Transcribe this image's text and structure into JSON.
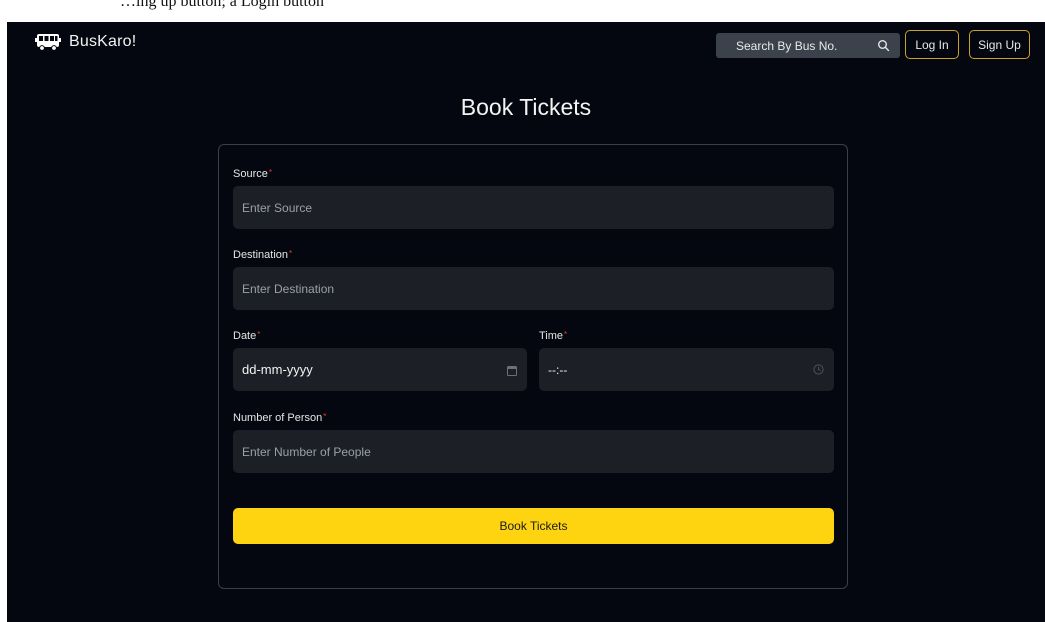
{
  "top_strip": {
    "text": "…ing up button; a Login button"
  },
  "navbar": {
    "brand_name": "BusKaro!",
    "brand_icon": "bus-icon",
    "search_placeholder": "Search By Bus No.",
    "search_icon": "search-icon",
    "login_label": "Log In",
    "signup_label": "Sign Up",
    "accent_color": "#c9a227"
  },
  "page": {
    "title": "Book Tickets"
  },
  "form": {
    "required_marker": "*",
    "source": {
      "label": "Source",
      "placeholder": "Enter Source"
    },
    "destination": {
      "label": "Destination",
      "placeholder": "Enter Destination"
    },
    "date": {
      "label": "Date",
      "value": "dd-mm-yyyy",
      "icon": "calendar-icon"
    },
    "time": {
      "label": "Time",
      "value": "--:--",
      "icon": "clock-icon"
    },
    "people": {
      "label": "Number of Person",
      "placeholder": "Enter Number of People"
    },
    "submit_label": "Book Tickets",
    "submit_color": "#fdd40f"
  }
}
